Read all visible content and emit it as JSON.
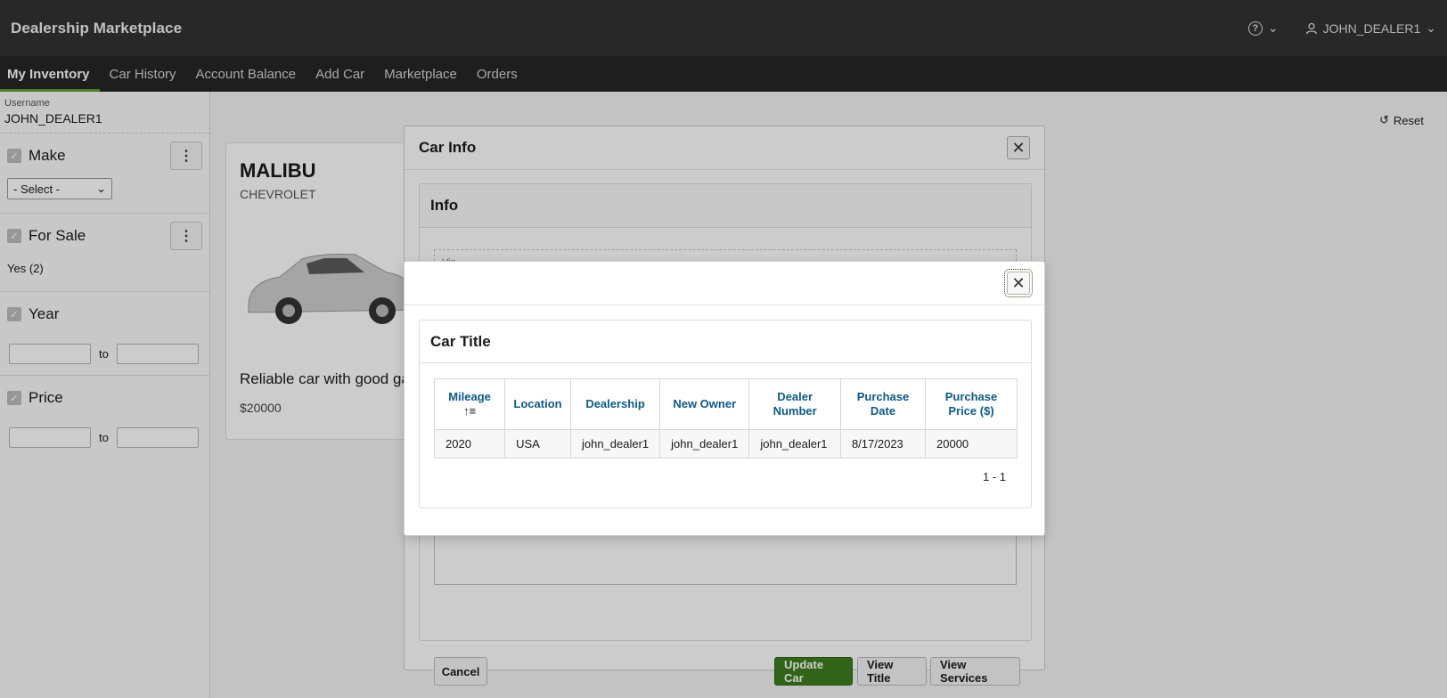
{
  "app": {
    "title": "Dealership Marketplace",
    "help_icon": "?",
    "username_menu": "JOHN_DEALER1"
  },
  "nav": {
    "tabs": [
      {
        "label": "My Inventory",
        "active": true
      },
      {
        "label": "Car History"
      },
      {
        "label": "Account Balance"
      },
      {
        "label": "Add Car"
      },
      {
        "label": "Marketplace"
      },
      {
        "label": "Orders"
      }
    ]
  },
  "sidebar": {
    "username_label": "Username",
    "username_value": "JOHN_DEALER1",
    "facets": {
      "make": {
        "title": "Make",
        "select_value": "- Select -"
      },
      "for_sale": {
        "title": "For Sale",
        "option": "Yes",
        "count": "(2)"
      },
      "year": {
        "title": "Year",
        "to": "to"
      },
      "price": {
        "title": "Price",
        "to": "to"
      }
    }
  },
  "main": {
    "reset_label": "Reset",
    "card": {
      "model": "MALIBU",
      "make": "CHEVROLET",
      "description": "Reliable car with good gas",
      "price": "$20000"
    }
  },
  "car_info_dialog": {
    "title": "Car Info",
    "section": "Info",
    "vin_label": "Vin",
    "buttons": {
      "cancel": "Cancel",
      "update": "Update Car",
      "view_title": "View Title",
      "view_services": "View Services"
    }
  },
  "title_dialog": {
    "region_title": "Car Title",
    "columns": [
      "Mileage",
      "Location",
      "Dealership",
      "New Owner",
      "Dealer Number",
      "Purchase Date",
      "Purchase Price ($)"
    ],
    "rows": [
      [
        "2020",
        "USA",
        "john_dealer1",
        "john_dealer1",
        "john_dealer1",
        "8/17/2023",
        "20000"
      ]
    ],
    "pagination": "1 - 1"
  },
  "colors": {
    "header_bg": "#323232",
    "nav_bg": "#262626",
    "active_tab_accent": "#5aa02c",
    "primary_button": "#3f7d1e",
    "table_header_text": "#0d5a88"
  }
}
